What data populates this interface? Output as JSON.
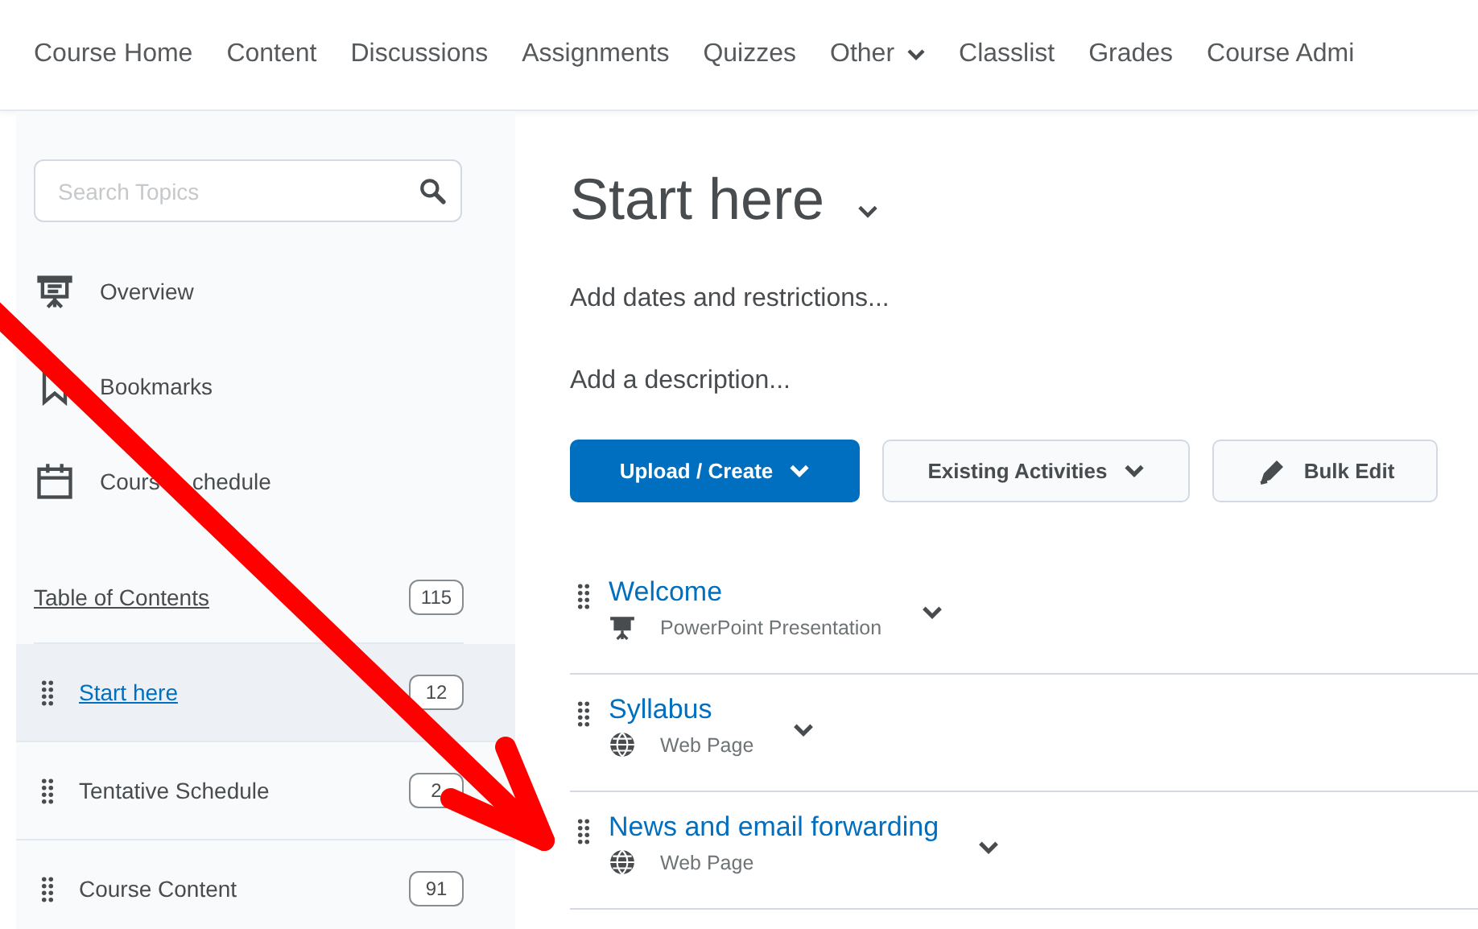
{
  "nav": {
    "items": [
      {
        "label": "Course Home",
        "dropdown": false
      },
      {
        "label": "Content",
        "dropdown": false
      },
      {
        "label": "Discussions",
        "dropdown": false
      },
      {
        "label": "Assignments",
        "dropdown": false
      },
      {
        "label": "Quizzes",
        "dropdown": false
      },
      {
        "label": "Other",
        "dropdown": true
      },
      {
        "label": "Classlist",
        "dropdown": false
      },
      {
        "label": "Grades",
        "dropdown": false
      },
      {
        "label": "Course Admi",
        "dropdown": false
      }
    ]
  },
  "sidebar": {
    "search": {
      "placeholder": "Search Topics"
    },
    "links": [
      {
        "label": "Overview",
        "kind": "overview"
      },
      {
        "label": "Bookmarks",
        "kind": "bookmarks"
      },
      {
        "label": "Cours",
        "label_end": "chedule",
        "kind": "schedule"
      }
    ],
    "toc": {
      "label": "Table of Contents",
      "count": "115"
    },
    "modules": [
      {
        "label": "Start here",
        "count": "12",
        "selected": true
      },
      {
        "label": "Tentative Schedule",
        "count": "2",
        "selected": false
      },
      {
        "label": "Course Content",
        "count": "91",
        "selected": false
      }
    ]
  },
  "main": {
    "title": "Start here",
    "dates_link": "Add dates and restrictions...",
    "description_link": "Add a description...",
    "buttons": [
      {
        "label": "Upload / Create",
        "kind": "primary"
      },
      {
        "label": "Existing Activities",
        "kind": "dropdown"
      },
      {
        "label": "Bulk Edit",
        "kind": "edit"
      }
    ],
    "items": [
      {
        "title": "Welcome",
        "type": "PowerPoint Presentation",
        "kind": "presentation"
      },
      {
        "title": "Syllabus",
        "type": "Web Page",
        "kind": "web"
      },
      {
        "title": "News and email forwarding",
        "type": "Web Page",
        "kind": "web"
      }
    ]
  },
  "annotation": {
    "kind": "arrow"
  }
}
